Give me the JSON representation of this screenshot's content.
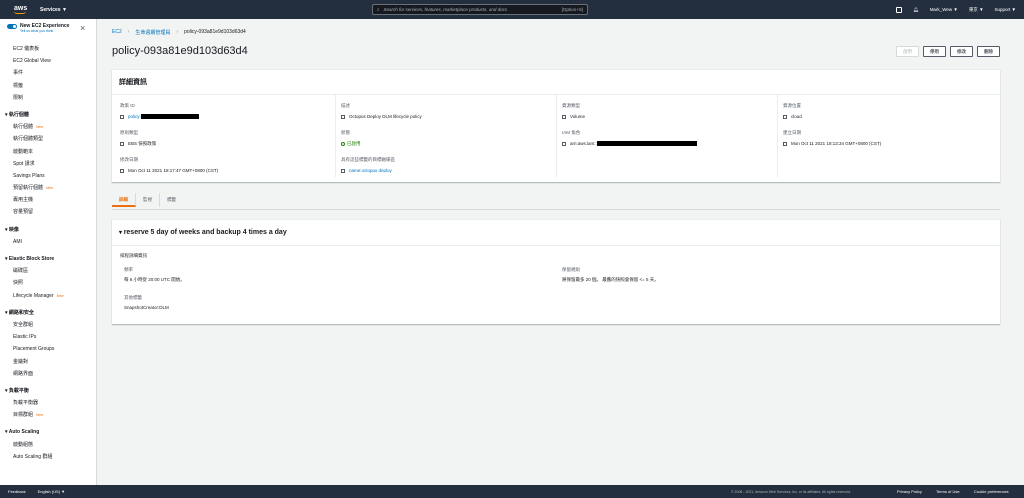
{
  "topbar": {
    "logo": "aws",
    "services": "Services ▼",
    "search_placeholder": "Search for services, features, marketplace products, and docs",
    "search_hint": "[Option+S]",
    "user": "Mark_Wew ▼",
    "region": "東京 ▼",
    "support": "Support ▼"
  },
  "sidebar": {
    "new_experience": "New EC2 Experience",
    "tell_us": "Tell us what you think",
    "top_items": [
      "EC2 儀表板",
      "EC2 Global View",
      "事件",
      "標籤",
      "限制"
    ],
    "sections": [
      {
        "title": "執行個體",
        "items": [
          {
            "label": "執行個體",
            "new": "New"
          },
          {
            "label": "執行個體類型",
            "new": ""
          },
          {
            "label": "啟動範本",
            "new": ""
          },
          {
            "label": "Spot 請求",
            "new": ""
          },
          {
            "label": "Savings Plans",
            "new": ""
          },
          {
            "label": "預留執行個體",
            "new": "New"
          },
          {
            "label": "專用主機",
            "new": ""
          },
          {
            "label": "容量預留",
            "new": ""
          }
        ]
      },
      {
        "title": "映像",
        "items": [
          {
            "label": "AMI",
            "new": ""
          }
        ]
      },
      {
        "title": "Elastic Block Store",
        "items": [
          {
            "label": "磁碟區",
            "new": ""
          },
          {
            "label": "快照",
            "new": ""
          },
          {
            "label": "Lifecycle Manager",
            "new": "New"
          }
        ]
      },
      {
        "title": "網路和安全",
        "items": [
          {
            "label": "安全群組",
            "new": ""
          },
          {
            "label": "Elastic IPs",
            "new": ""
          },
          {
            "label": "Placement Groups",
            "new": ""
          },
          {
            "label": "金鑰對",
            "new": ""
          },
          {
            "label": "網路界面",
            "new": ""
          }
        ]
      },
      {
        "title": "負載平衡",
        "items": [
          {
            "label": "負載平衡器",
            "new": ""
          },
          {
            "label": "目標群組",
            "new": "New"
          }
        ]
      },
      {
        "title": "Auto Scaling",
        "items": [
          {
            "label": "啟動組態",
            "new": ""
          },
          {
            "label": "Auto Scaling 群組",
            "new": ""
          }
        ]
      }
    ]
  },
  "breadcrumb": {
    "ec2": "EC2",
    "lifecycle": "生命週期管理員",
    "current": "policy-093a81e9d103d63d4"
  },
  "page_title": "policy-093a81e9d103d63d4",
  "actions": {
    "disabled": "啟用",
    "stop": "停用",
    "modify": "修改",
    "delete": "刪除"
  },
  "details": {
    "title": "詳細資訊",
    "policy_id_label": "政策 ID",
    "policy_id_value": "policy-",
    "description_label": "描述",
    "description_value": "Octopus Deploy DLM lifecycle policy",
    "resource_type_label": "資源類型",
    "resource_type_value": "Volume",
    "resource_location_label": "資源位置",
    "resource_location_value": "cloud",
    "policy_type_label": "原則類型",
    "policy_type_value": "EBS 快照政策",
    "status_label": "狀態",
    "status_value": "已啟用",
    "iam_label": "IAM 角色",
    "iam_value": "arn:aws:iam::",
    "created_label": "建立日期",
    "created_value": "Mon Oct 11 2021 18:13:34 GMT+0800 (CST)",
    "modified_label": "修改日期",
    "modified_value": "Mon Oct 11 2021 18:17:47 GMT+0800 (CST)",
    "target_tags_label": "具有這些標籤的目標磁碟區",
    "target_tags_value": "name:octopus deploy"
  },
  "tabs": [
    "詳細",
    "監視",
    "標籤"
  ],
  "schedule": {
    "title": "reserve 5 day of weeks and backup 4 times a day",
    "subtitle": "排程詳細資訊",
    "frequency_label": "頻率",
    "frequency_value": "每 6 小時從 20:00 UTC 開始。",
    "retention_label": "保留規則",
    "retention_value": "將保留最多 20 個。 最舊的快照會保留 <= 5 天。",
    "other_tags_label": "其他標籤",
    "other_tags_value": "SnapshotCreator:DLM"
  },
  "footer": {
    "feedback": "Feedback",
    "language": "English (US) ▼",
    "copyright": "© 2008 - 2021, Amazon Web Services, Inc. or its affiliates. All rights reserved.",
    "privacy": "Privacy Policy",
    "terms": "Terms of Use",
    "cookies": "Cookie preferences"
  },
  "colors": {
    "nav_bg": "#232f3e",
    "link": "#0073bb",
    "accent": "#ec7211",
    "success": "#1d8102"
  }
}
